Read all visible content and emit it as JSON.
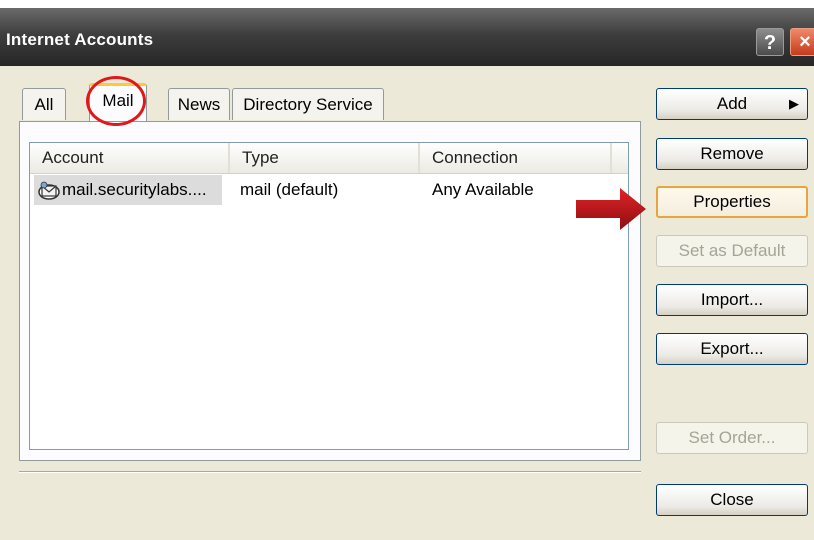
{
  "window": {
    "title": "Internet Accounts",
    "help_label": "?",
    "close_label": "×"
  },
  "tabs": [
    {
      "label": "All"
    },
    {
      "label": "Mail",
      "active": true
    },
    {
      "label": "News"
    },
    {
      "label": "Directory Service"
    }
  ],
  "accounts_list": {
    "columns": [
      "Account",
      "Type",
      "Connection"
    ],
    "rows": [
      {
        "account": "mail.securitylabs....",
        "type": "mail (default)",
        "connection": "Any Available"
      }
    ]
  },
  "buttons": {
    "add": "Add",
    "remove": "Remove",
    "properties": "Properties",
    "set_default": "Set as Default",
    "import": "Import...",
    "export": "Export...",
    "set_order": "Set Order...",
    "close": "Close"
  },
  "annotations": {
    "highlight_color": "#e01818",
    "arrow_color": "#c0161a"
  },
  "icons": {
    "account": "mail-account-icon",
    "add_arrow": "triangle-right"
  }
}
